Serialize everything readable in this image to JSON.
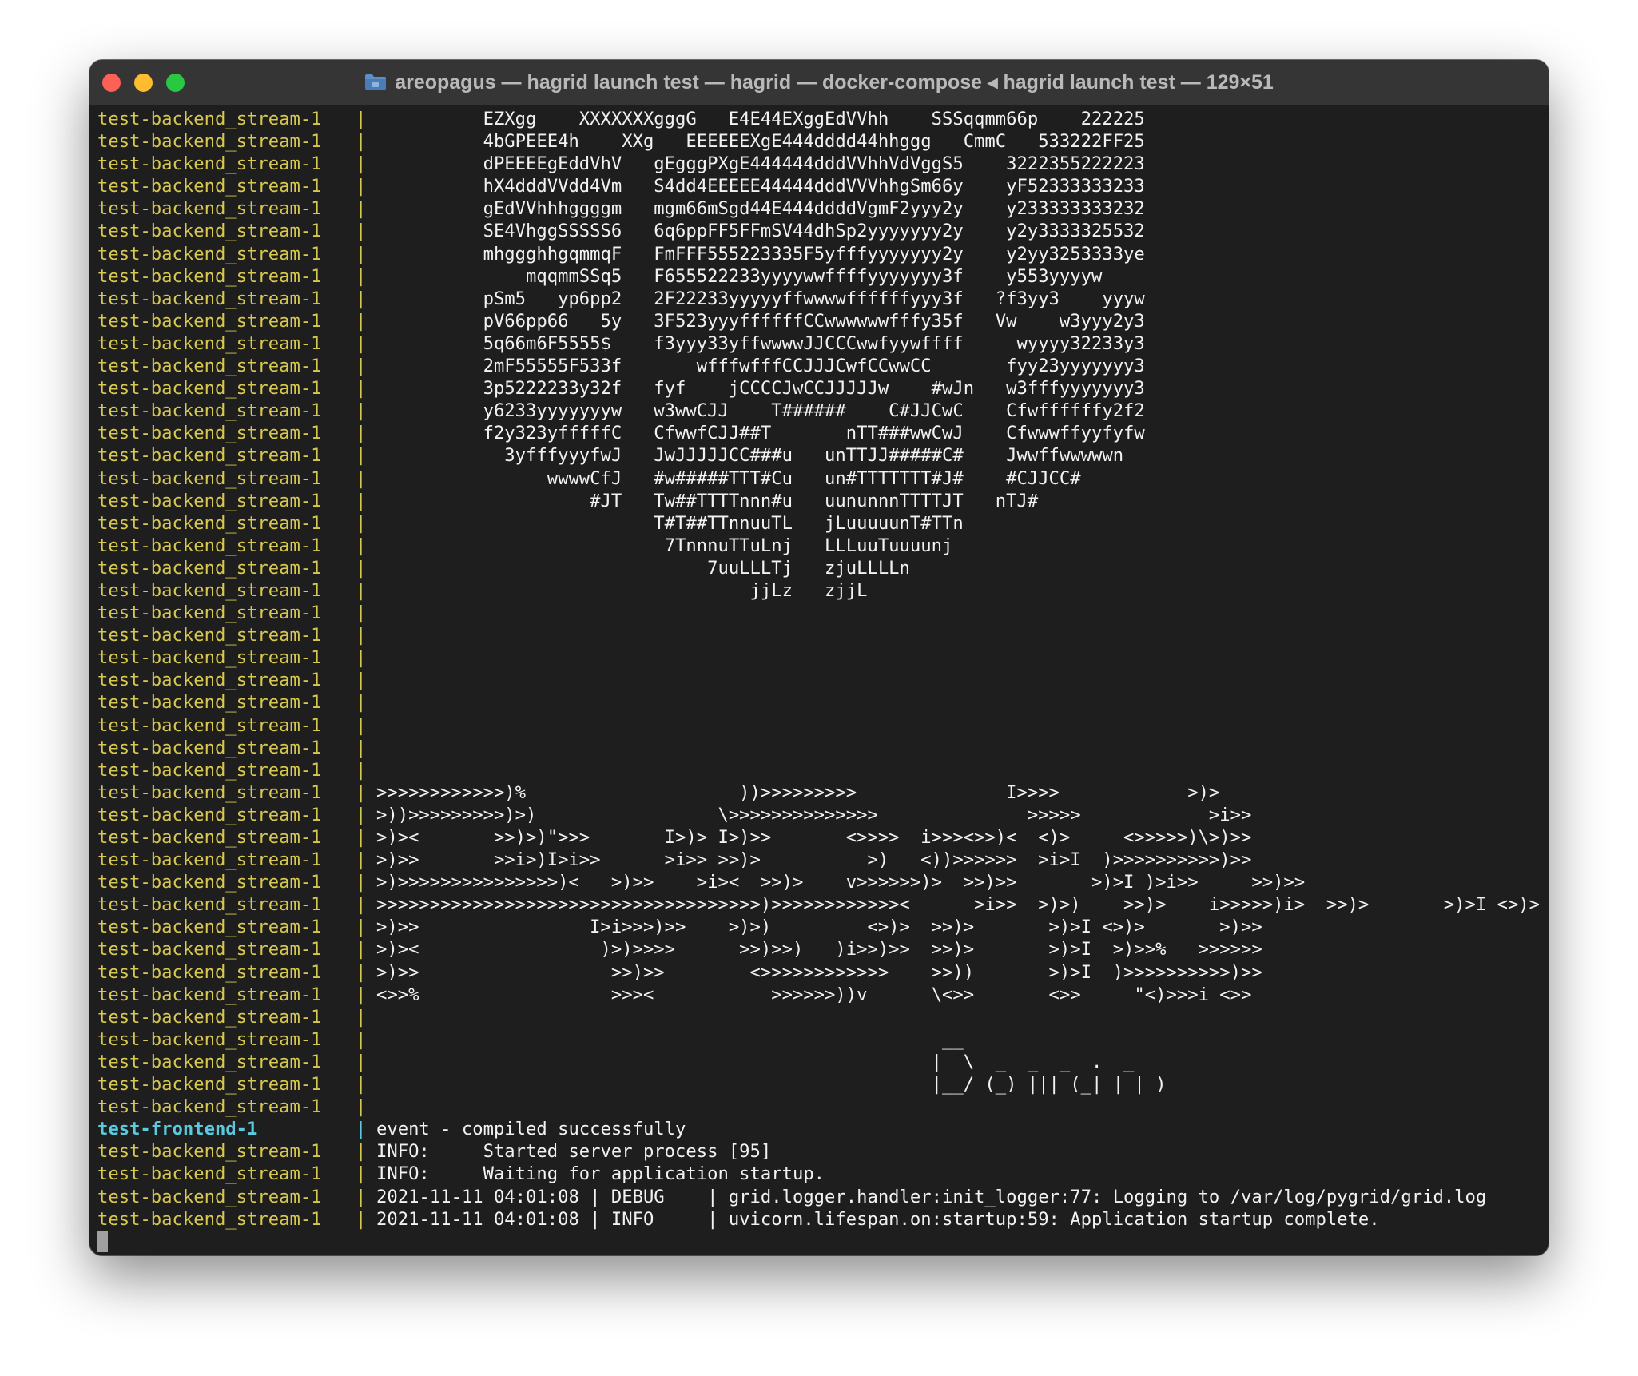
{
  "window": {
    "title": "areopagus — hagrid launch test — hagrid — docker-compose ◂ hagrid launch test — 129×51",
    "icon": "folder-icon"
  },
  "terminal": {
    "lines": [
      {
        "service": "test-backend_stream-1",
        "msg": "          EZXgg    XXXXXXXgggG   E4E44EXggEdVVhh    SSSqqmm66p    222225"
      },
      {
        "service": "test-backend_stream-1",
        "msg": "          4bGPEEE4h    XXg   EEEEEEXgE444dddd44hhggg   CmmC   533222FF25"
      },
      {
        "service": "test-backend_stream-1",
        "msg": "          dPEEEEgEddVhV   gEgggPXgE444444dddVVhhVdVggS5    3222355222223"
      },
      {
        "service": "test-backend_stream-1",
        "msg": "          hX4dddVVdd4Vm   S4dd4EEEEE44444dddVVVhhgSm66y    yF52333333233"
      },
      {
        "service": "test-backend_stream-1",
        "msg": "          gEdVVhhhggggm   mgm66mSgd44E444ddddVgmF2yyy2y    y233333333232"
      },
      {
        "service": "test-backend_stream-1",
        "msg": "          SE4VhggSSSSS6   6q6ppFF5FFmSV44dhSp2yyyyyyy2y    y2y3333325532"
      },
      {
        "service": "test-backend_stream-1",
        "msg": "          mhggghhgqmmqF   FmFFF555223335F5yfffyyyyyyy2y    y2yy3253333ye"
      },
      {
        "service": "test-backend_stream-1",
        "msg": "              mqqmmSSq5   F655522233yyyywwffffyyyyyyy3f    y553yyyyw"
      },
      {
        "service": "test-backend_stream-1",
        "msg": "          pSm5   yp6pp2   2F22233yyyyyffwwwwffffffyyy3f   ?f3yy3    yyyw"
      },
      {
        "service": "test-backend_stream-1",
        "msg": "          pV66pp66   5y   3F523yyyffffffCCwwwwwwfffy35f   Vw    w3yyy2y3"
      },
      {
        "service": "test-backend_stream-1",
        "msg": "          5q66m6F5555$    f3yyy33yffwwwwJJCCCwwfyywffff     wyyyy32233y3"
      },
      {
        "service": "test-backend_stream-1",
        "msg": "          2mF55555F533f       wfffwfffCCJJJCwfCCwwCC       fyy23yyyyyyy3"
      },
      {
        "service": "test-backend_stream-1",
        "msg": "          3p5222233y32f   fyf    jCCCCJwCCJJJJJw    #wJn   w3fffyyyyyyy3"
      },
      {
        "service": "test-backend_stream-1",
        "msg": "          y6233yyyyyyyw   w3wwCJJ    T######    C#JJCwC    Cfwffffffy2f2"
      },
      {
        "service": "test-backend_stream-1",
        "msg": "          f2y323yfffffC   CfwwfCJJ##T       nTT###wwCwJ    Cfwwwffyyfyfw"
      },
      {
        "service": "test-backend_stream-1",
        "msg": "            3yfffyyyfwJ   JwJJJJJCC###u   unTTJJ#####C#    Jwwffwwwwwn"
      },
      {
        "service": "test-backend_stream-1",
        "msg": "                wwwwCfJ   #w#####TTT#Cu   un#TTTTTTT#J#    #CJJCC#"
      },
      {
        "service": "test-backend_stream-1",
        "msg": "                    #JT   Tw##TTTTnnn#u   uununnnTTTTJT   nTJ#"
      },
      {
        "service": "test-backend_stream-1",
        "msg": "                          T#T##TTnnuuTL   jLuuuuunT#TTn"
      },
      {
        "service": "test-backend_stream-1",
        "msg": "                           7TnnnuTTuLnj   LLLuuTuuuunj"
      },
      {
        "service": "test-backend_stream-1",
        "msg": "                               7uuLLLTj   zjuLLLLn"
      },
      {
        "service": "test-backend_stream-1",
        "msg": "                                   jjLz   zjjL"
      },
      {
        "service": "test-backend_stream-1",
        "msg": ""
      },
      {
        "service": "test-backend_stream-1",
        "msg": ""
      },
      {
        "service": "test-backend_stream-1",
        "msg": ""
      },
      {
        "service": "test-backend_stream-1",
        "msg": ""
      },
      {
        "service": "test-backend_stream-1",
        "msg": ""
      },
      {
        "service": "test-backend_stream-1",
        "msg": ""
      },
      {
        "service": "test-backend_stream-1",
        "msg": ""
      },
      {
        "service": "test-backend_stream-1",
        "msg": ""
      },
      {
        "service": "test-backend_stream-1",
        "msg": ">>>>>>>>>>>>)%                    ))>>>>>>>>>              I>>>>            >)>"
      },
      {
        "service": "test-backend_stream-1",
        "msg": ">))>>>>>>>>>)>)                 \\>>>>>>>>>>>>>>              >>>>>            >i>>"
      },
      {
        "service": "test-backend_stream-1",
        "msg": ">)><       >>)>)\">>>       I>)> I>)>>       <>>>>  i>>><>>)<  <)>     <>>>>>)\\>)>>"
      },
      {
        "service": "test-backend_stream-1",
        "msg": ">)>>       >>i>)I>i>>      >i>> >>)>          >)   <))>>>>>>  >i>I  )>>>>>>>>>>)>>"
      },
      {
        "service": "test-backend_stream-1",
        "msg": ">)>>>>>>>>>>>>>>>)<   >)>>    >i><  >>)>    v>>>>>>)>  >>)>>       >)>I )>i>>     >>)>>"
      },
      {
        "service": "test-backend_stream-1",
        "msg": ">>>>>>>>>>>>>>>>>>>>>>>>>>>>>>>>>>>>)>>>>>>>>>>>><      >i>>  >)>)    >>)>    i>>>>>)i>  >>)>       >)>I <>)>       >)>>"
      },
      {
        "service": "test-backend_stream-1",
        "msg": ">)>>                I>i>>>)>>    >)>)         <>)>  >>)>       >)>I <>)>       >)>>"
      },
      {
        "service": "test-backend_stream-1",
        "msg": ">)><                 )>)>>>>      >>)>>)   )i>>)>>  >>)>       >)>I  >)>>%   >>>>>>"
      },
      {
        "service": "test-backend_stream-1",
        "msg": ">)>>                  >>)>>        <>>>>>>>>>>>>    >>))       >)>I  )>>>>>>>>>>)>>"
      },
      {
        "service": "test-backend_stream-1",
        "msg": "<>>%                  >>><           >>>>>>))v      \\<>>       <>>     \"<)>>>i <>>"
      },
      {
        "service": "test-backend_stream-1",
        "msg": ""
      },
      {
        "service": "test-backend_stream-1",
        "msg": "                                                     __"
      },
      {
        "service": "test-backend_stream-1",
        "msg": "                                                    |  \\  _  _  _  .  _"
      },
      {
        "service": "test-backend_stream-1",
        "msg": "                                                    |__/ (_) ||| (_| | | )"
      },
      {
        "service": "test-backend_stream-1",
        "msg": ""
      },
      {
        "service": "test-frontend-1",
        "frontend": true,
        "msg": "event - compiled successfully"
      },
      {
        "service": "test-backend_stream-1",
        "msg": "INFO:     Started server process [95]"
      },
      {
        "service": "test-backend_stream-1",
        "msg": "INFO:     Waiting for application startup."
      },
      {
        "service": "test-backend_stream-1",
        "msg": "2021-11-11 04:01:08 | DEBUG    | grid.logger.handler:init_logger:77: Logging to /var/log/pygrid/grid.log"
      },
      {
        "service": "test-backend_stream-1",
        "msg": "2021-11-11 04:01:08 | INFO     | uvicorn.lifespan.on:startup:59: Application startup complete."
      }
    ],
    "separator": "|",
    "cursor": "block"
  }
}
